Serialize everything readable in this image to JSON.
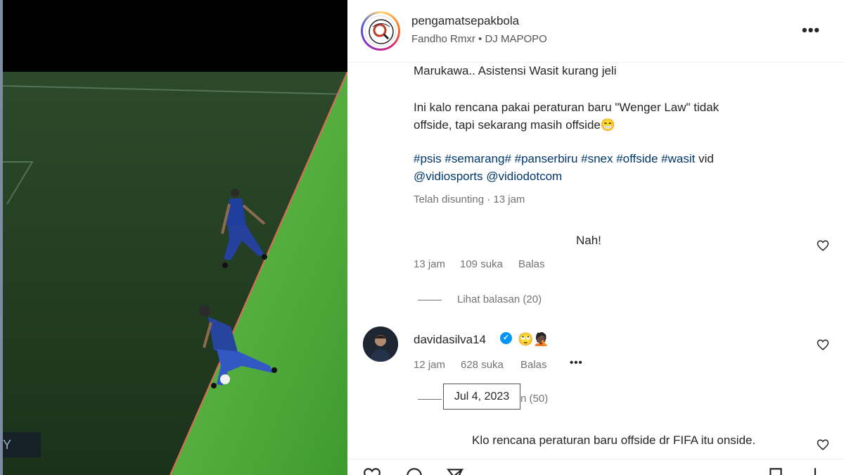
{
  "post": {
    "username": "pengamatsepakbola",
    "audio": "Fandho Rmxr • DJ MAPOPO",
    "video_overlay_text": "Y"
  },
  "caption": {
    "line1": "Marukawa.. Asistensi Wasit kurang jeli",
    "line2": "Ini kalo rencana pakai peraturan baru \"Wenger Law\" tidak",
    "line3": "offside, tapi sekarang masih offside😁",
    "hashtags": "#psis #semarang# #panserbiru #snex #offside #wasit",
    "hashtags_suffix": " vid",
    "mentions": "@vidiosports @vidiodotcom",
    "edited_meta": "Telah disunting · 13 jam"
  },
  "comments": [
    {
      "text": "Nah!",
      "time": "13 jam",
      "likes": "109 suka",
      "reply": "Balas",
      "view_replies": "Lihat balasan (20)"
    },
    {
      "username": "davidasilva14",
      "emojis": "🙄🤦🏿",
      "time": "12 jam",
      "likes": "628 suka",
      "reply": "Balas",
      "more": "•••",
      "view_replies_tail": "n (50)",
      "tooltip": "Jul 4, 2023"
    },
    {
      "text": "Klo rencana peraturan baru offside dr FIFA itu onside."
    }
  ],
  "icons": {
    "more": "•••",
    "heart": "heart-icon",
    "comment": "comment-icon",
    "share": "share-icon",
    "bookmark": "bookmark-icon"
  },
  "colors": {
    "link": "#00376b",
    "verified": "#0095f6",
    "meta_text": "#737373",
    "pitch_dark": "#1f3a1d",
    "pitch_light": "#4fa83a",
    "jersey": "#1f3f9e"
  }
}
